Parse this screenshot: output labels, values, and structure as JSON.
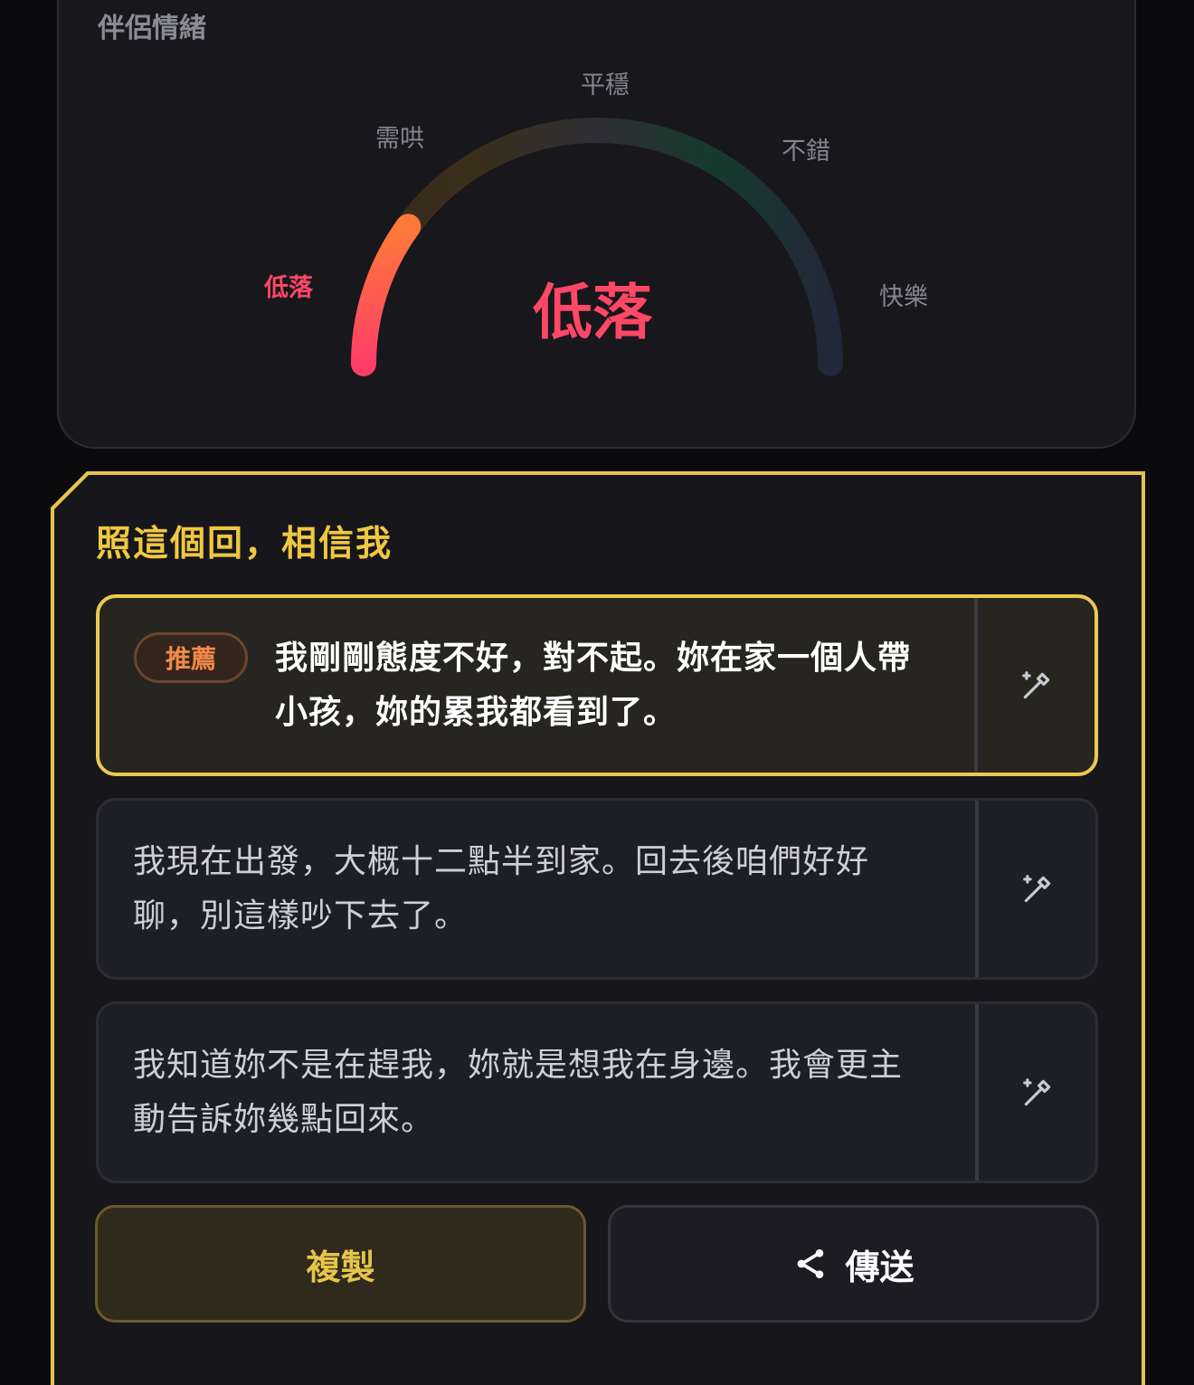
{
  "mood": {
    "title": "伴侶情緒",
    "scale": [
      "低落",
      "需哄",
      "平穩",
      "不錯",
      "快樂"
    ],
    "value_label": "低落",
    "level": 0.2,
    "colors": {
      "low": "#ff4766",
      "mid": "#f28a30",
      "track": "#2a2a30"
    }
  },
  "replies": {
    "title": "照這個回，相信我",
    "options": [
      {
        "badge": "推薦",
        "line1": "我剛剛態度不好，對不起。妳在家一個人帶",
        "line2": "小孩，妳的累我都看到了。"
      },
      {
        "line1": "我現在出發，大概十二點半到家。回去後咱們好好",
        "line2": "聊，別這樣吵下去了。"
      },
      {
        "line1": "我知道妳不是在趕我，妳就是想我在身邊。我會更主",
        "line2": "動告訴妳幾點回來。"
      }
    ],
    "edit_icon": "magic-wand-icon"
  },
  "actions": {
    "copy_label": "複製",
    "send_label": "傳送",
    "send_icon": "share-icon"
  }
}
